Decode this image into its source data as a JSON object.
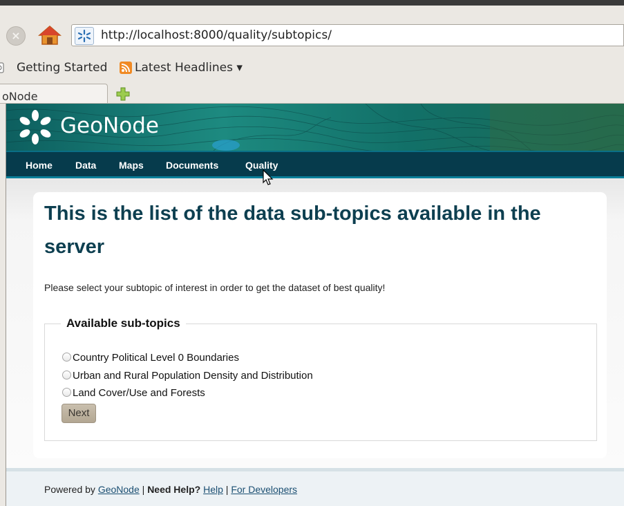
{
  "browser": {
    "url": "http://localhost:8000/quality/subtopics/",
    "bookmarks": [
      "Getting Started",
      "Latest Headlines ▾"
    ],
    "tab_title": "oNode"
  },
  "site": {
    "logo": "GeoNode",
    "nav": [
      "Home",
      "Data",
      "Maps",
      "Documents",
      "Quality"
    ]
  },
  "page": {
    "heading_line1": "This is the list of the data sub-topics available in the",
    "heading_line2": "server",
    "intro": "Please select your subtopic of interest in order to get the dataset of best quality!",
    "legend": "Available sub-topics",
    "options": [
      "Country Political Level 0 Boundaries",
      "Urban and Rural Population Density and Distribution",
      "Land Cover/Use and Forests"
    ],
    "next_label": "Next"
  },
  "footer": {
    "powered_by": "Powered by ",
    "geonode_link": "GeoNode",
    "sep1": " | ",
    "need_help": "Need Help?",
    "help_link": "Help",
    "sep2": " | ",
    "dev_link": "For Developers"
  },
  "colors": {
    "navbar": "#063b4c",
    "heading": "#0d3f50",
    "button": "#b3a792",
    "header_teal": "#1d7f7a"
  },
  "icons": [
    "stop-icon",
    "home-icon",
    "site-favicon-icon",
    "bookmark-icon",
    "rss-icon",
    "new-tab-plus-icon",
    "geonode-logo-icon",
    "mouse-cursor-icon"
  ]
}
